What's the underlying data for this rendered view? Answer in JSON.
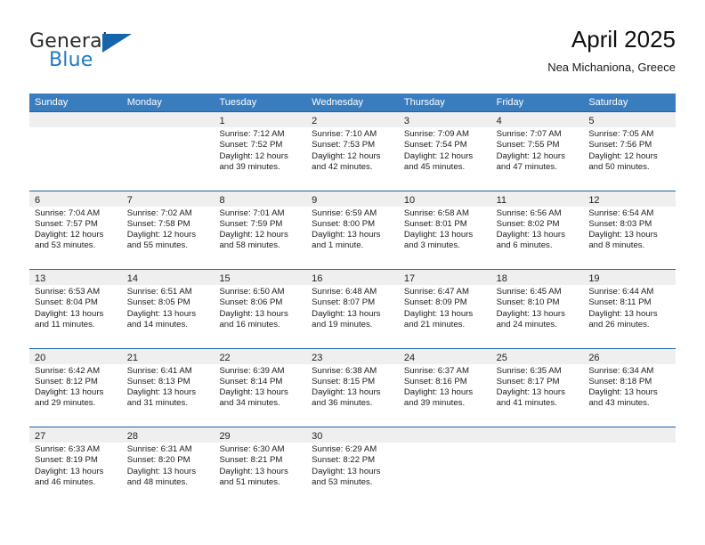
{
  "brand": {
    "word_one": "General",
    "word_two": "Blue",
    "logo_icon": "triangle-logo-icon",
    "accent_color": "#1565ad"
  },
  "header": {
    "title": "April 2025",
    "location": "Nea Michaniona, Greece"
  },
  "theme": {
    "header_blue": "#3a7dbf",
    "row_border_blue": "#1565ad",
    "day_strip_gray": "#efefef"
  },
  "calendar": {
    "weekdays": [
      "Sunday",
      "Monday",
      "Tuesday",
      "Wednesday",
      "Thursday",
      "Friday",
      "Saturday"
    ],
    "weeks": [
      [
        {
          "day": "",
          "lines": []
        },
        {
          "day": "",
          "lines": []
        },
        {
          "day": "1",
          "lines": [
            "Sunrise: 7:12 AM",
            "Sunset: 7:52 PM",
            "Daylight: 12 hours",
            "and 39 minutes."
          ]
        },
        {
          "day": "2",
          "lines": [
            "Sunrise: 7:10 AM",
            "Sunset: 7:53 PM",
            "Daylight: 12 hours",
            "and 42 minutes."
          ]
        },
        {
          "day": "3",
          "lines": [
            "Sunrise: 7:09 AM",
            "Sunset: 7:54 PM",
            "Daylight: 12 hours",
            "and 45 minutes."
          ]
        },
        {
          "day": "4",
          "lines": [
            "Sunrise: 7:07 AM",
            "Sunset: 7:55 PM",
            "Daylight: 12 hours",
            "and 47 minutes."
          ]
        },
        {
          "day": "5",
          "lines": [
            "Sunrise: 7:05 AM",
            "Sunset: 7:56 PM",
            "Daylight: 12 hours",
            "and 50 minutes."
          ]
        }
      ],
      [
        {
          "day": "6",
          "lines": [
            "Sunrise: 7:04 AM",
            "Sunset: 7:57 PM",
            "Daylight: 12 hours",
            "and 53 minutes."
          ]
        },
        {
          "day": "7",
          "lines": [
            "Sunrise: 7:02 AM",
            "Sunset: 7:58 PM",
            "Daylight: 12 hours",
            "and 55 minutes."
          ]
        },
        {
          "day": "8",
          "lines": [
            "Sunrise: 7:01 AM",
            "Sunset: 7:59 PM",
            "Daylight: 12 hours",
            "and 58 minutes."
          ]
        },
        {
          "day": "9",
          "lines": [
            "Sunrise: 6:59 AM",
            "Sunset: 8:00 PM",
            "Daylight: 13 hours",
            "and 1 minute."
          ]
        },
        {
          "day": "10",
          "lines": [
            "Sunrise: 6:58 AM",
            "Sunset: 8:01 PM",
            "Daylight: 13 hours",
            "and 3 minutes."
          ]
        },
        {
          "day": "11",
          "lines": [
            "Sunrise: 6:56 AM",
            "Sunset: 8:02 PM",
            "Daylight: 13 hours",
            "and 6 minutes."
          ]
        },
        {
          "day": "12",
          "lines": [
            "Sunrise: 6:54 AM",
            "Sunset: 8:03 PM",
            "Daylight: 13 hours",
            "and 8 minutes."
          ]
        }
      ],
      [
        {
          "day": "13",
          "lines": [
            "Sunrise: 6:53 AM",
            "Sunset: 8:04 PM",
            "Daylight: 13 hours",
            "and 11 minutes."
          ]
        },
        {
          "day": "14",
          "lines": [
            "Sunrise: 6:51 AM",
            "Sunset: 8:05 PM",
            "Daylight: 13 hours",
            "and 14 minutes."
          ]
        },
        {
          "day": "15",
          "lines": [
            "Sunrise: 6:50 AM",
            "Sunset: 8:06 PM",
            "Daylight: 13 hours",
            "and 16 minutes."
          ]
        },
        {
          "day": "16",
          "lines": [
            "Sunrise: 6:48 AM",
            "Sunset: 8:07 PM",
            "Daylight: 13 hours",
            "and 19 minutes."
          ]
        },
        {
          "day": "17",
          "lines": [
            "Sunrise: 6:47 AM",
            "Sunset: 8:09 PM",
            "Daylight: 13 hours",
            "and 21 minutes."
          ]
        },
        {
          "day": "18",
          "lines": [
            "Sunrise: 6:45 AM",
            "Sunset: 8:10 PM",
            "Daylight: 13 hours",
            "and 24 minutes."
          ]
        },
        {
          "day": "19",
          "lines": [
            "Sunrise: 6:44 AM",
            "Sunset: 8:11 PM",
            "Daylight: 13 hours",
            "and 26 minutes."
          ]
        }
      ],
      [
        {
          "day": "20",
          "lines": [
            "Sunrise: 6:42 AM",
            "Sunset: 8:12 PM",
            "Daylight: 13 hours",
            "and 29 minutes."
          ]
        },
        {
          "day": "21",
          "lines": [
            "Sunrise: 6:41 AM",
            "Sunset: 8:13 PM",
            "Daylight: 13 hours",
            "and 31 minutes."
          ]
        },
        {
          "day": "22",
          "lines": [
            "Sunrise: 6:39 AM",
            "Sunset: 8:14 PM",
            "Daylight: 13 hours",
            "and 34 minutes."
          ]
        },
        {
          "day": "23",
          "lines": [
            "Sunrise: 6:38 AM",
            "Sunset: 8:15 PM",
            "Daylight: 13 hours",
            "and 36 minutes."
          ]
        },
        {
          "day": "24",
          "lines": [
            "Sunrise: 6:37 AM",
            "Sunset: 8:16 PM",
            "Daylight: 13 hours",
            "and 39 minutes."
          ]
        },
        {
          "day": "25",
          "lines": [
            "Sunrise: 6:35 AM",
            "Sunset: 8:17 PM",
            "Daylight: 13 hours",
            "and 41 minutes."
          ]
        },
        {
          "day": "26",
          "lines": [
            "Sunrise: 6:34 AM",
            "Sunset: 8:18 PM",
            "Daylight: 13 hours",
            "and 43 minutes."
          ]
        }
      ],
      [
        {
          "day": "27",
          "lines": [
            "Sunrise: 6:33 AM",
            "Sunset: 8:19 PM",
            "Daylight: 13 hours",
            "and 46 minutes."
          ]
        },
        {
          "day": "28",
          "lines": [
            "Sunrise: 6:31 AM",
            "Sunset: 8:20 PM",
            "Daylight: 13 hours",
            "and 48 minutes."
          ]
        },
        {
          "day": "29",
          "lines": [
            "Sunrise: 6:30 AM",
            "Sunset: 8:21 PM",
            "Daylight: 13 hours",
            "and 51 minutes."
          ]
        },
        {
          "day": "30",
          "lines": [
            "Sunrise: 6:29 AM",
            "Sunset: 8:22 PM",
            "Daylight: 13 hours",
            "and 53 minutes."
          ]
        },
        {
          "day": "",
          "lines": []
        },
        {
          "day": "",
          "lines": []
        },
        {
          "day": "",
          "lines": []
        }
      ]
    ]
  }
}
